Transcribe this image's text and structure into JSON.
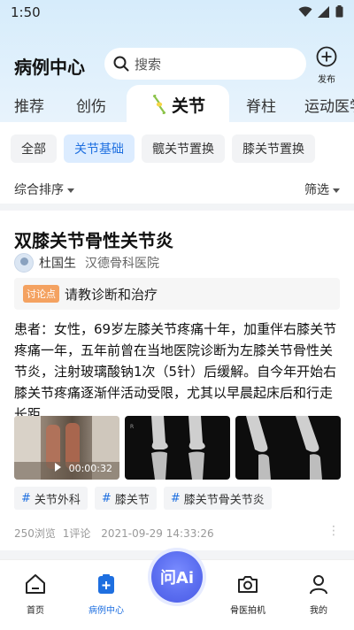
{
  "status": {
    "time": "1:50"
  },
  "header": {
    "title": "病例中心",
    "search_placeholder": "搜索",
    "publish_label": "发布"
  },
  "tabs": [
    {
      "label": "推荐"
    },
    {
      "label": "创伤"
    },
    {
      "label": "关节",
      "active": true
    },
    {
      "label": "脊柱"
    },
    {
      "label": "运动医学"
    }
  ],
  "chips": [
    {
      "label": "全部"
    },
    {
      "label": "关节基础",
      "active": true
    },
    {
      "label": "髋关节置换"
    },
    {
      "label": "膝关节置换"
    }
  ],
  "sort": {
    "left": "综合排序",
    "right": "筛选"
  },
  "post": {
    "title": "双膝关节骨性关节炎",
    "author": "杜国生",
    "hospital": "汉德骨科医院",
    "discuss_badge": "讨论点",
    "discuss_text": "请教诊断和治疗",
    "body": "患者：女性，69岁左膝关节疼痛十年，加重伴右膝关节疼痛一年，五年前曾在当地医院诊断为左膝关节骨性关节炎，注射玻璃酸钠1次（5针）后缓解。自今年开始右膝关节疼痛逐渐伴活动受限，尤其以早晨起床后和行走长距",
    "video_duration": "00:00:32",
    "tags": [
      "关节外科",
      "膝关节",
      "膝关节骨关节炎"
    ],
    "views": "250浏览",
    "comments": "1评论",
    "datetime": "2021-09-29 14:33:26"
  },
  "nav": [
    {
      "label": "首页"
    },
    {
      "label": "病例中心",
      "active": true
    },
    {
      "label": "问Ai"
    },
    {
      "label": "骨医拍机"
    },
    {
      "label": "我的"
    }
  ],
  "colors": {
    "accent": "#1e6fe0",
    "ai_button": "#5b6ef0",
    "discuss_badge": "#f4a261"
  }
}
